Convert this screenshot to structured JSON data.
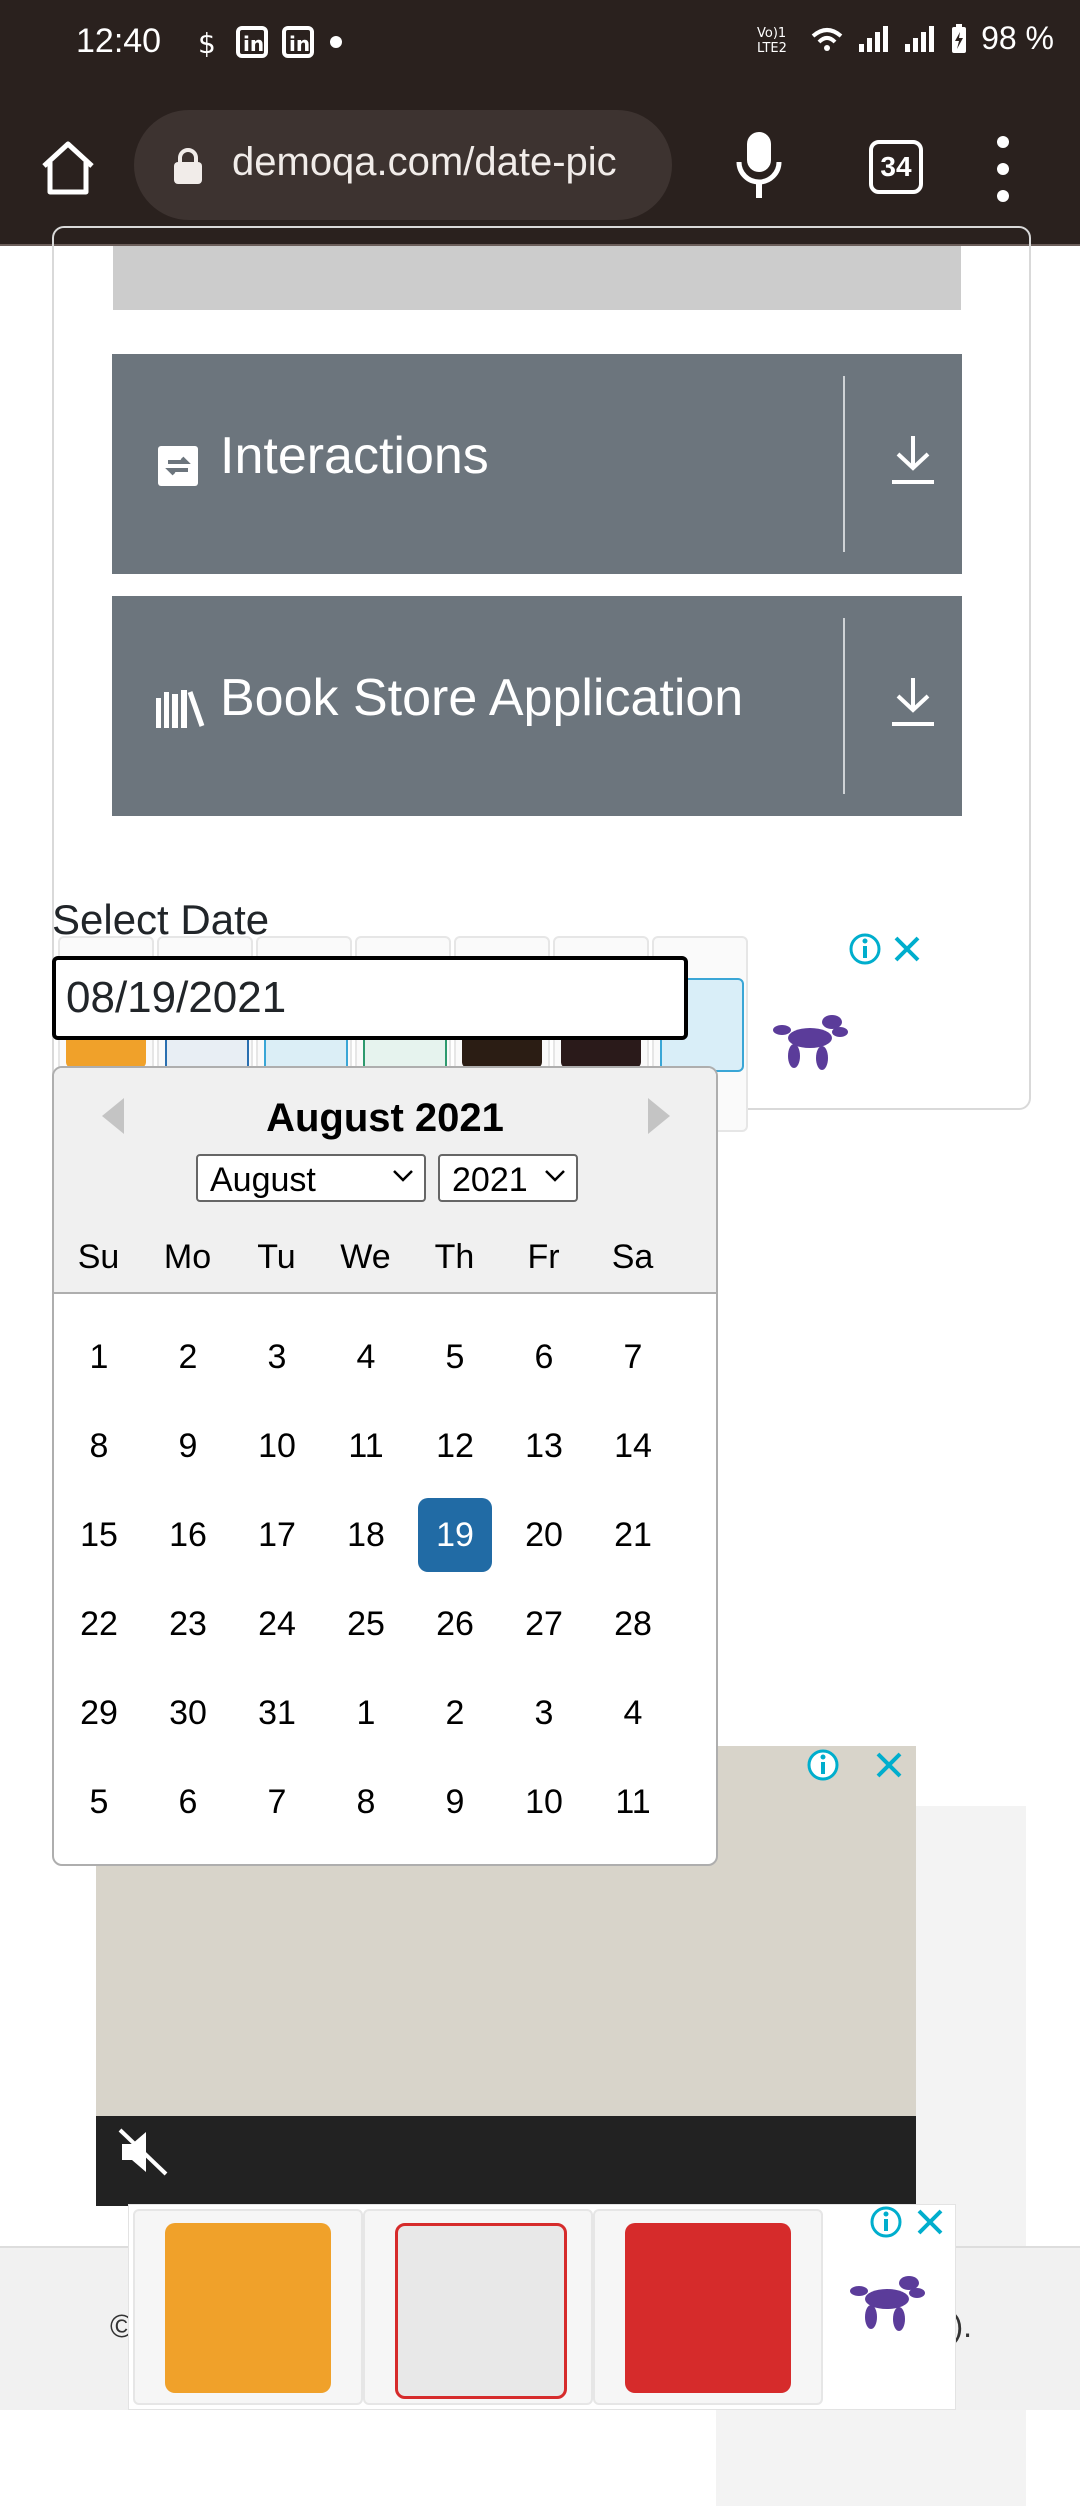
{
  "status_bar": {
    "time": "12:40",
    "battery": "98 %"
  },
  "browser": {
    "url": "demoqa.com/date-pic",
    "tab_count": "34"
  },
  "menu_cards": [
    {
      "label": "Interactions"
    },
    {
      "label": "Book Store Application"
    }
  ],
  "form": {
    "select_label": "Select Date",
    "date_value": "08/19/2021"
  },
  "calendar": {
    "title": "August 2021",
    "month_select": "August",
    "year_select": "2021",
    "weekdays": [
      "Su",
      "Mo",
      "Tu",
      "We",
      "Th",
      "Fr",
      "Sa"
    ],
    "weeks": [
      [
        "1",
        "2",
        "3",
        "4",
        "5",
        "6",
        "7"
      ],
      [
        "8",
        "9",
        "10",
        "11",
        "12",
        "13",
        "14"
      ],
      [
        "15",
        "16",
        "17",
        "18",
        "19",
        "20",
        "21"
      ],
      [
        "22",
        "23",
        "24",
        "25",
        "26",
        "27",
        "28"
      ],
      [
        "29",
        "30",
        "31",
        "1",
        "2",
        "3",
        "4"
      ],
      [
        "5",
        "6",
        "7",
        "8",
        "9",
        "10",
        "11"
      ]
    ],
    "selected_day": "19"
  },
  "footer": {
    "left": "©",
    "right": ")."
  },
  "colors": {
    "card_bg": "#6c757d",
    "selected_day_bg": "#216ba5",
    "header_bg": "#f0f0f0",
    "chrome_bg": "#2a211e",
    "ad_info_blue": "#00aecd"
  }
}
